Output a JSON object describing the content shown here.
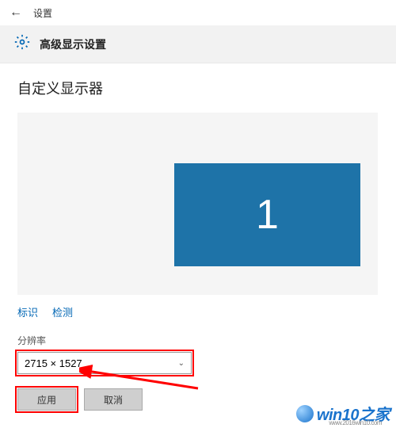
{
  "header": {
    "back_label": "←",
    "title": "设置"
  },
  "subheader": {
    "title": "高级显示设置"
  },
  "page": {
    "title": "自定义显示器"
  },
  "monitor": {
    "number": "1"
  },
  "links": {
    "identify": "标识",
    "detect": "检测"
  },
  "resolution": {
    "label": "分辨率",
    "value": "2715 × 1527"
  },
  "buttons": {
    "apply": "应用",
    "cancel": "取消"
  },
  "watermark": {
    "text": "win10之家",
    "url": "www.2016win10.com"
  },
  "colors": {
    "accent": "#1e73a8",
    "link": "#0066b4",
    "highlight": "#ff0000"
  }
}
